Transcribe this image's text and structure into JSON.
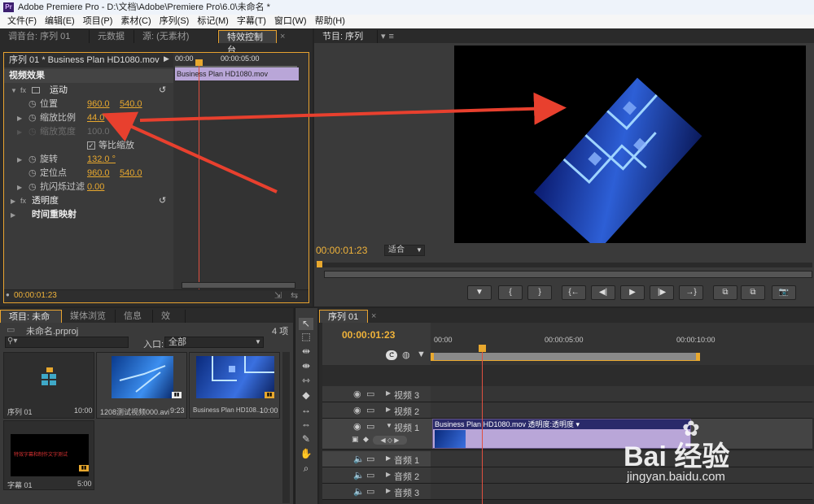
{
  "window": {
    "title": "Adobe Premiere Pro - D:\\文档\\Adobe\\Premiere Pro\\6.0\\未命名 *",
    "icon": "Pr"
  },
  "menu": [
    "文件(F)",
    "编辑(E)",
    "项目(P)",
    "素材(C)",
    "序列(S)",
    "标记(M)",
    "字幕(T)",
    "窗口(W)",
    "帮助(H)"
  ],
  "source_tabs": [
    "调音台: 序列 01",
    "元数据",
    "源: (无素材)",
    "特效控制台"
  ],
  "effects": {
    "header": "序列 01 * Business Plan HD1080.mov",
    "ruler_start": "00:00",
    "ruler_mid": "00:00:05:00",
    "clip_label": "Business Plan HD1080.mov",
    "section": "视频效果",
    "motion": "运动",
    "position_label": "位置",
    "position_x": "960.0",
    "position_y": "540.0",
    "scale_label": "缩放比例",
    "scale_value": "44.0",
    "scale_width_label": "缩放宽度",
    "scale_width_value": "100.0",
    "uniform_label": "等比缩放",
    "rotation_label": "旋转",
    "rotation_value": "132.0 °",
    "anchor_label": "定位点",
    "anchor_x": "960.0",
    "anchor_y": "540.0",
    "antiflicker_label": "抗闪烁过滤",
    "antiflicker_value": "0.00",
    "opacity": "透明度",
    "time_remap": "时间重映射",
    "timecode": "00:00:01:23"
  },
  "program": {
    "tab": "节目: 序列 01",
    "timecode": "00:00:01:23",
    "fit": "适合"
  },
  "transport": [
    "▼",
    "{",
    "}",
    "{←",
    "◀|",
    "▶",
    "|▶",
    "→}",
    "⧉",
    "⧉",
    "📷"
  ],
  "project": {
    "tabs": [
      "项目: 未命名",
      "媒体浏览器",
      "信息",
      "效果"
    ],
    "file": "未命名.prproj",
    "count": "4 项",
    "search_placeholder": "",
    "entry_label": "入口:",
    "entry_value": "全部",
    "items": [
      {
        "name": "序列 01",
        "dur": "10:00"
      },
      {
        "name": "1208测试视频000.avi",
        "dur": "9:23"
      },
      {
        "name": "Business Plan HD108...",
        "dur": "10:00"
      },
      {
        "name": "字幕 01",
        "dur": "5:00"
      }
    ],
    "title_thumb_text": "特效字幕和制作文字测试"
  },
  "timeline": {
    "tab": "序列 01",
    "timecode": "00:00:01:23",
    "ruler": [
      "00:00",
      "00:00:05:00",
      "00:00:10:00"
    ],
    "tracks": [
      {
        "name": "视频 3"
      },
      {
        "name": "视频 2"
      },
      {
        "name": "视频 1"
      },
      {
        "name": "音频 1"
      },
      {
        "name": "音频 2"
      },
      {
        "name": "音频 3"
      }
    ],
    "clip_label": "Business Plan HD1080.mov  透明度:透明度 ▾"
  },
  "watermark": {
    "brand": "Bai 经验",
    "url": "jingyan.baidu.com"
  },
  "colors": {
    "accent": "#e8a82e",
    "panel": "#3a3a3a",
    "clip": "#b9a6d8",
    "playhead": "#e05040",
    "arrow": "#e8402e"
  }
}
